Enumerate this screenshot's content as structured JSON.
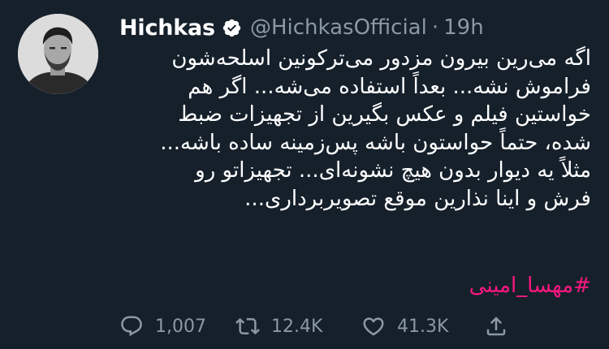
{
  "tweet": {
    "display_name": "Hichkas",
    "handle": "@HichkasOfficial",
    "separator": "·",
    "time": "19h",
    "lines": [
      "اگه می‌رین بیرون مزدور می‌ترکونین اسلحه‌شون",
      "فراموش نشه... بعداً استفاده می‌شه... اگر هم",
      "خواستین فیلم و عکس بگیرین از تجهیزات ضبط",
      "شده، حتماً حواستون باشه پس‌زمینه ساده باشه...",
      "مثلاً یه دیوار بدون هیچ نشونه‌ای... تجهیزاتو رو",
      "فرش و اینا نذارین موقع تصویربرداری..."
    ],
    "hashtag": "#مهسا_امینی",
    "actions": {
      "reply_count": "1,007",
      "retweet_count": "12.4K",
      "like_count": "41.3K"
    }
  },
  "colors": {
    "background": "#15202b",
    "text": "#ffffff",
    "secondary": "#8b98a5",
    "hashtag": "#f91880"
  },
  "icons": {
    "verified": "verified-badge-icon",
    "reply": "reply-icon",
    "retweet": "retweet-icon",
    "like": "heart-icon",
    "share": "share-icon"
  }
}
